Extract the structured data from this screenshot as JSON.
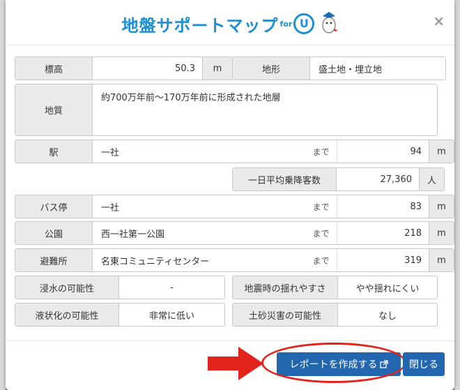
{
  "header": {
    "title": "地盤サポートマップ",
    "for": "for",
    "u": "U",
    "close": "×"
  },
  "fields": {
    "elevation": {
      "label": "標高",
      "value": "50.3",
      "unit": "m"
    },
    "landform": {
      "label": "地形",
      "value": "盛土地・埋立地"
    },
    "geology": {
      "label": "地質",
      "value": "約700万年前～170万年前に形成された地層"
    },
    "station": {
      "label": "駅",
      "name": "一社",
      "made": "まで",
      "value": "94",
      "unit": "m"
    },
    "passengers": {
      "label": "一日平均乗降客数",
      "value": "27,360",
      "unit": "人"
    },
    "bus": {
      "label": "バス停",
      "name": "一社",
      "made": "まで",
      "value": "83",
      "unit": "m"
    },
    "park": {
      "label": "公園",
      "name": "西一社第一公園",
      "made": "まで",
      "value": "218",
      "unit": "m"
    },
    "shelter": {
      "label": "避難所",
      "name": "名東コミュニティセンター",
      "made": "まで",
      "value": "319",
      "unit": "m"
    },
    "flood": {
      "label": "浸水の可能性",
      "value": "-"
    },
    "quake": {
      "label": "地震時の揺れやすさ",
      "value": "やや揺れにくい"
    },
    "liquefaction": {
      "label": "液状化の可能性",
      "value": "非常に低い"
    },
    "landslide": {
      "label": "土砂災害の可能性",
      "value": "なし"
    }
  },
  "footer": {
    "report_button": "レポートを作成する",
    "close_button": "閉じる"
  },
  "colors": {
    "brand": "#1e8fd2",
    "button": "#2266b0",
    "annotation": "#e2241c"
  }
}
